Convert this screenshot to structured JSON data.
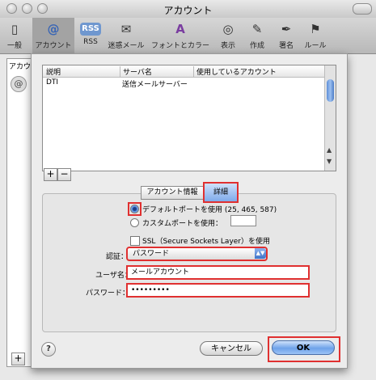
{
  "window": {
    "title": "アカウント"
  },
  "toolbar": {
    "items": [
      {
        "label": "一般",
        "icon": "switch-icon"
      },
      {
        "label": "アカウント",
        "icon": "at-icon"
      },
      {
        "label": "RSS",
        "icon": "rss-icon"
      },
      {
        "label": "迷惑メール",
        "icon": "junk-mail-icon"
      },
      {
        "label": "フォントとカラー",
        "icon": "font-icon"
      },
      {
        "label": "表示",
        "icon": "glasses-icon"
      },
      {
        "label": "作成",
        "icon": "compose-icon"
      },
      {
        "label": "署名",
        "icon": "signature-icon"
      },
      {
        "label": "ルール",
        "icon": "rules-icon"
      }
    ],
    "rss_badge": "RSS",
    "at_glyph": "@"
  },
  "left_pane": {
    "header": "アカウ"
  },
  "table": {
    "columns": [
      "説明",
      "サーバ名",
      "使用しているアカウント"
    ],
    "rows": [
      [
        "DTI",
        "送信メールサーバー",
        ""
      ]
    ]
  },
  "buttons": {
    "add": "+",
    "remove": "−",
    "cancel": "キャンセル",
    "ok": "OK",
    "help": "?",
    "main_add": "+"
  },
  "tabs": {
    "account_info": "アカウント情報",
    "advanced": "詳細"
  },
  "port": {
    "default_label": "デフォルトポートを使用 (25, 465, 587)",
    "custom_label": "カスタムポートを使用：",
    "custom_value": ""
  },
  "ssl": {
    "label": "SSL（Secure Sockets Layer）を使用"
  },
  "auth": {
    "label": "認証：",
    "value": "パスワード"
  },
  "username": {
    "label": "ユーザ名：",
    "value": "メールアカウント"
  },
  "password": {
    "label": "パスワード：",
    "value": "•••••••••"
  },
  "colors": {
    "highlight": "#e03030",
    "accent": "#5a8fe0"
  }
}
